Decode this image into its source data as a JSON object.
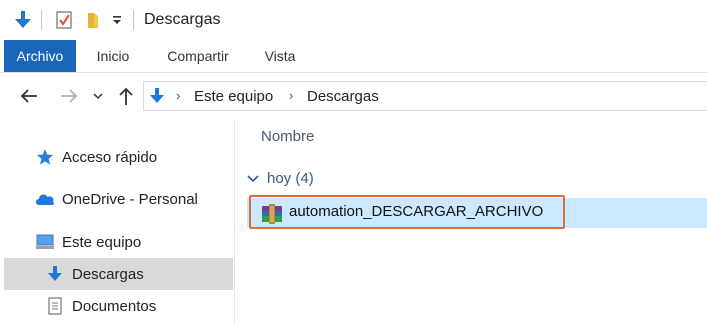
{
  "window": {
    "title": "Descargas"
  },
  "quick_access": {
    "icons": [
      "download-arrow-icon",
      "properties-checkbox-icon",
      "new-folder-icon",
      "customize-dropdown-icon"
    ]
  },
  "ribbon": {
    "tabs": [
      {
        "label": "Archivo",
        "active": true
      },
      {
        "label": "Inicio",
        "active": false
      },
      {
        "label": "Compartir",
        "active": false
      },
      {
        "label": "Vista",
        "active": false
      }
    ]
  },
  "address": {
    "crumbs": [
      "Este equipo",
      "Descargas"
    ],
    "icon": "download-arrow-icon"
  },
  "nav_pane": {
    "items": [
      {
        "label": "Acceso rápido",
        "icon": "star-icon",
        "selected": false
      },
      {
        "label": "OneDrive - Personal",
        "icon": "cloud-icon",
        "selected": false
      },
      {
        "label": "Este equipo",
        "icon": "computer-icon",
        "selected": false
      },
      {
        "label": "Descargas",
        "icon": "download-arrow-icon",
        "selected": true
      },
      {
        "label": "Documentos",
        "icon": "document-icon",
        "selected": false
      }
    ]
  },
  "content": {
    "column_header": "Nombre",
    "group_label": "hoy (4)",
    "files": [
      {
        "name": "automation_DESCARGAR_ARCHIVO",
        "icon": "archive-icon",
        "selected": true
      }
    ]
  },
  "colors": {
    "accent": "#1a66b8",
    "selection": "#cce8ff",
    "highlight_border": "#e06a3c",
    "nav_selected": "#d9d9d9"
  }
}
